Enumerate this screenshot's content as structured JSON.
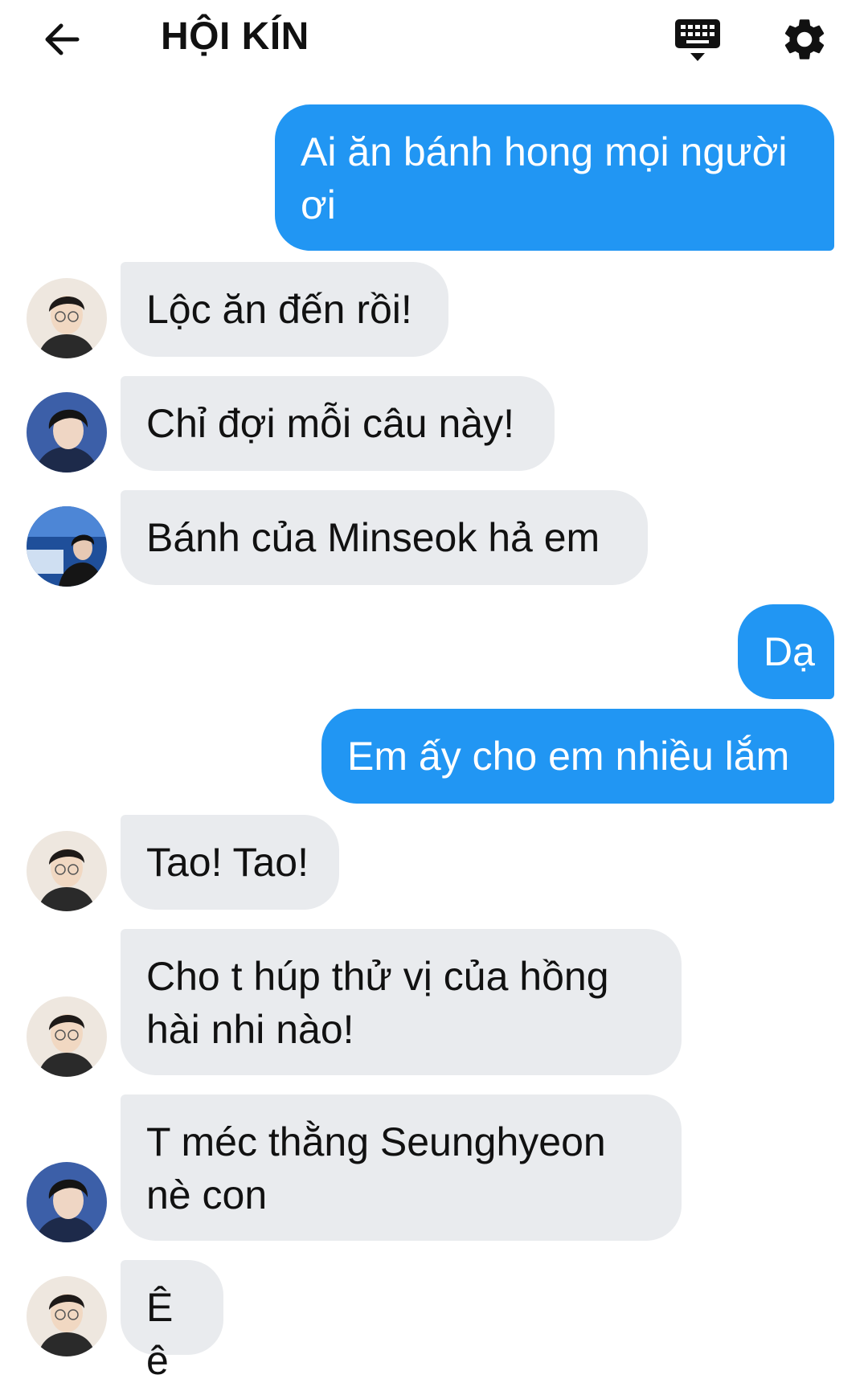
{
  "header": {
    "title": "HỘI KÍN",
    "icons": {
      "back": "arrow-left-icon",
      "keyboard": "keyboard-icon",
      "settings": "gear-icon"
    }
  },
  "colors": {
    "outgoing_bubble": "#2196f3",
    "incoming_bubble": "#e9ebee",
    "outgoing_text": "#ffffff",
    "incoming_text": "#111111"
  },
  "messages": [
    {
      "direction": "out",
      "text": "Ai ăn bánh hong mọi người ơi"
    },
    {
      "direction": "in",
      "avatar": "avatar-a",
      "text": "Lộc ăn đến rồi!"
    },
    {
      "direction": "in",
      "avatar": "avatar-b",
      "text": "Chỉ đợi mỗi câu này!"
    },
    {
      "direction": "in",
      "avatar": "avatar-c",
      "text": "Bánh của Minseok hả em"
    },
    {
      "direction": "out",
      "text": "Dạ"
    },
    {
      "direction": "out",
      "text": "Em ấy cho em nhiều lắm"
    },
    {
      "direction": "in",
      "avatar": "avatar-a",
      "text": "Tao! Tao!"
    },
    {
      "direction": "in",
      "avatar": "avatar-a",
      "text": "Cho t húp thử vị của hồng hài nhi nào!"
    },
    {
      "direction": "in",
      "avatar": "avatar-b",
      "text": "T méc thằng Seunghyeon nè con"
    },
    {
      "direction": "in",
      "avatar": "avatar-a",
      "text": "Ê ê"
    }
  ]
}
